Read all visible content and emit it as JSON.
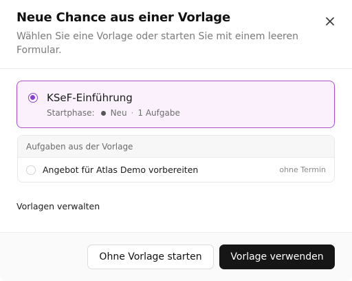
{
  "dialog": {
    "title": "Neue Chance aus einer Vorlage",
    "subtitle": "Wählen Sie eine Vorlage oder starten Sie mit einem leeren Formular.",
    "close_icon": "close-icon"
  },
  "template": {
    "name": "KSeF-Einführung",
    "selected": true,
    "start_phase_label": "Startphase:",
    "start_phase_value": "Neu",
    "separator": "·",
    "task_count": "1 Aufgabe"
  },
  "tasks": {
    "header": "Aufgaben aus der Vorlage",
    "items": [
      {
        "label": "Angebot für Atlas Demo vorbereiten",
        "due": "ohne Termin"
      }
    ]
  },
  "manage_link": "Vorlagen verwalten",
  "footer": {
    "secondary_label": "Ohne Vorlage starten",
    "primary_label": "Vorlage verwenden"
  },
  "colors": {
    "accent": "#8b3fd0",
    "card_border": "#a650cf",
    "card_background": "#fbf1fc",
    "primary_button": "#161616"
  }
}
